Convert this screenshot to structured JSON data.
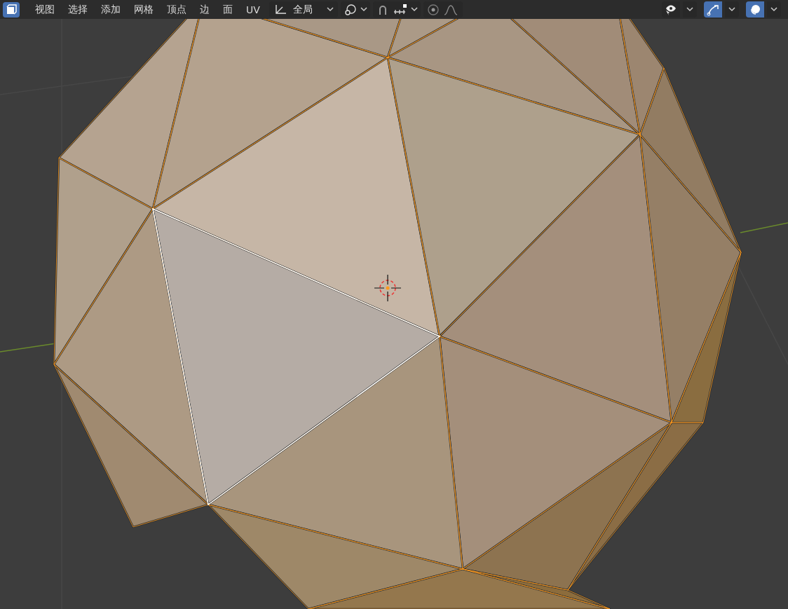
{
  "menus": [
    "视图",
    "选择",
    "添加",
    "网格",
    "顶点",
    "边",
    "面",
    "UV"
  ],
  "orientation": {
    "label": "全局"
  },
  "right_toggles": [
    {
      "kind": "visibility",
      "on": false
    },
    {
      "kind": "gizmo",
      "on": true
    },
    {
      "kind": "overlay",
      "on": true
    }
  ]
}
